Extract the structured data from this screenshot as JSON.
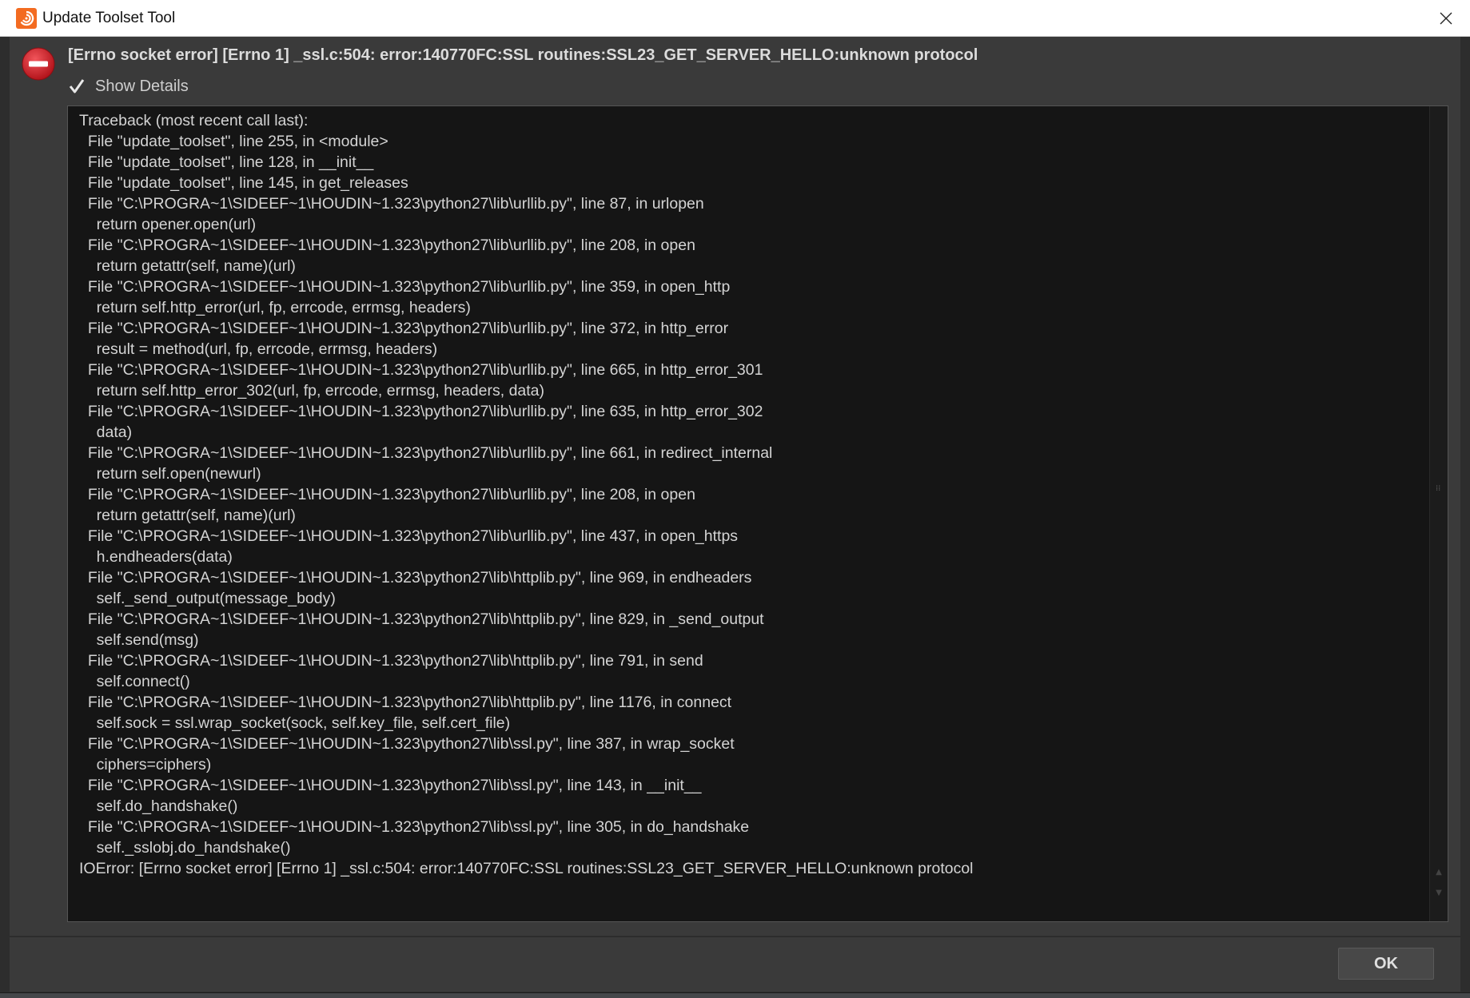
{
  "window": {
    "title": "Update Toolset Tool",
    "icons": {
      "app": "houdini-app-icon",
      "close": "close-icon"
    }
  },
  "dialog": {
    "error_message": "[Errno socket error] [Errno 1] _ssl.c:504: error:140770FC:SSL routines:SSL23_GET_SERVER_HELLO:unknown protocol",
    "error_icon": "error-stop-icon",
    "show_details": {
      "label": "Show Details",
      "checked": true
    },
    "traceback_lines": [
      "Traceback (most recent call last):",
      "  File \"update_toolset\", line 255, in <module>",
      "  File \"update_toolset\", line 128, in __init__",
      "  File \"update_toolset\", line 145, in get_releases",
      "  File \"C:\\PROGRA~1\\SIDEEF~1\\HOUDIN~1.323\\python27\\lib\\urllib.py\", line 87, in urlopen",
      "    return opener.open(url)",
      "  File \"C:\\PROGRA~1\\SIDEEF~1\\HOUDIN~1.323\\python27\\lib\\urllib.py\", line 208, in open",
      "    return getattr(self, name)(url)",
      "  File \"C:\\PROGRA~1\\SIDEEF~1\\HOUDIN~1.323\\python27\\lib\\urllib.py\", line 359, in open_http",
      "    return self.http_error(url, fp, errcode, errmsg, headers)",
      "  File \"C:\\PROGRA~1\\SIDEEF~1\\HOUDIN~1.323\\python27\\lib\\urllib.py\", line 372, in http_error",
      "    result = method(url, fp, errcode, errmsg, headers)",
      "  File \"C:\\PROGRA~1\\SIDEEF~1\\HOUDIN~1.323\\python27\\lib\\urllib.py\", line 665, in http_error_301",
      "    return self.http_error_302(url, fp, errcode, errmsg, headers, data)",
      "  File \"C:\\PROGRA~1\\SIDEEF~1\\HOUDIN~1.323\\python27\\lib\\urllib.py\", line 635, in http_error_302",
      "    data)",
      "  File \"C:\\PROGRA~1\\SIDEEF~1\\HOUDIN~1.323\\python27\\lib\\urllib.py\", line 661, in redirect_internal",
      "    return self.open(newurl)",
      "  File \"C:\\PROGRA~1\\SIDEEF~1\\HOUDIN~1.323\\python27\\lib\\urllib.py\", line 208, in open",
      "    return getattr(self, name)(url)",
      "  File \"C:\\PROGRA~1\\SIDEEF~1\\HOUDIN~1.323\\python27\\lib\\urllib.py\", line 437, in open_https",
      "    h.endheaders(data)",
      "  File \"C:\\PROGRA~1\\SIDEEF~1\\HOUDIN~1.323\\python27\\lib\\httplib.py\", line 969, in endheaders",
      "    self._send_output(message_body)",
      "  File \"C:\\PROGRA~1\\SIDEEF~1\\HOUDIN~1.323\\python27\\lib\\httplib.py\", line 829, in _send_output",
      "    self.send(msg)",
      "  File \"C:\\PROGRA~1\\SIDEEF~1\\HOUDIN~1.323\\python27\\lib\\httplib.py\", line 791, in send",
      "    self.connect()",
      "  File \"C:\\PROGRA~1\\SIDEEF~1\\HOUDIN~1.323\\python27\\lib\\httplib.py\", line 1176, in connect",
      "    self.sock = ssl.wrap_socket(sock, self.key_file, self.cert_file)",
      "  File \"C:\\PROGRA~1\\SIDEEF~1\\HOUDIN~1.323\\python27\\lib\\ssl.py\", line 387, in wrap_socket",
      "    ciphers=ciphers)",
      "  File \"C:\\PROGRA~1\\SIDEEF~1\\HOUDIN~1.323\\python27\\lib\\ssl.py\", line 143, in __init__",
      "    self.do_handshake()",
      "  File \"C:\\PROGRA~1\\SIDEEF~1\\HOUDIN~1.323\\python27\\lib\\ssl.py\", line 305, in do_handshake",
      "    self._sslobj.do_handshake()",
      "IOError: [Errno socket error] [Errno 1] _ssl.c:504: error:140770FC:SSL routines:SSL23_GET_SERVER_HELLO:unknown protocol"
    ]
  },
  "footer": {
    "ok_label": "OK"
  },
  "colors": {
    "accent": "#f36b21",
    "error_red": "#d9222a",
    "dialog_bg": "#3a3a3a",
    "text_bg": "#151515"
  }
}
